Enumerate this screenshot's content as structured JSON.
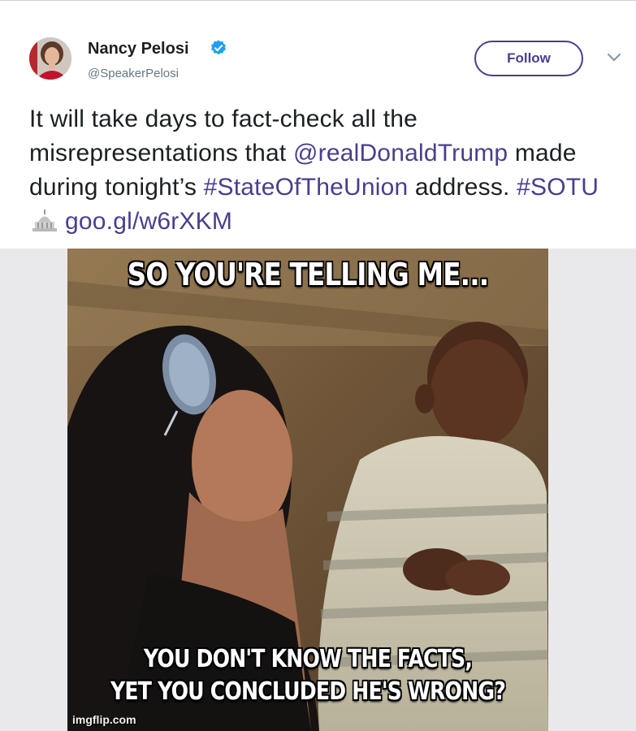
{
  "author": {
    "name": "Nancy Pelosi",
    "handle": "@SpeakerPelosi",
    "avatar_icon": "avatar-photo",
    "verified_icon": "verified-badge-icon",
    "verified_color": "#1da1f2"
  },
  "actions": {
    "follow_label": "Follow",
    "menu_icon": "chevron-down-icon"
  },
  "tweet": {
    "t1": "It will take days to fact-check all the misrepresentations that ",
    "mention": "@realDonaldTrump",
    "t2": " made during tonight’s ",
    "hashtag1": "#StateOfTheUnion",
    "t3": " address. ",
    "hashtag2": "#SOTU",
    "emoji_icon": "capitol-building-icon",
    "link": "goo.gl/w6rXKM",
    "link_color": "#4a3e8e"
  },
  "meme": {
    "top_text": "SO YOU'RE TELLING ME...",
    "bottom_line1": "YOU DON'T KNOW THE FACTS,",
    "bottom_line2": "YET YOU CONCLUDED HE'S WRONG?",
    "watermark": "imgflip.com"
  }
}
